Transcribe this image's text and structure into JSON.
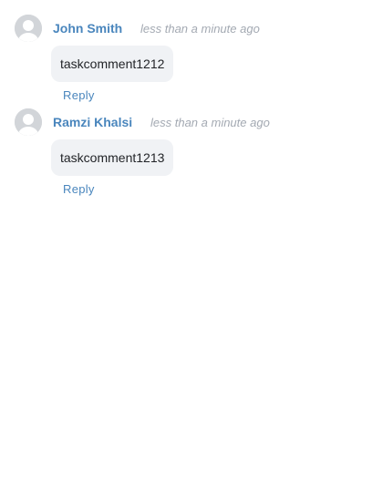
{
  "comments": [
    {
      "author": "John Smith",
      "timestamp": "less than a minute ago",
      "text": "taskcomment1212",
      "reply_label": "Reply",
      "avatar_icon": "default-user-avatar-icon"
    },
    {
      "author": "Ramzi Khalsi",
      "timestamp": "less than a minute ago",
      "text": "taskcomment1213",
      "reply_label": "Reply",
      "avatar_icon": "default-user-avatar-icon"
    }
  ],
  "colors": {
    "link": "#4a86bd",
    "muted": "#a3a9b2",
    "bubble": "#f0f2f5",
    "avatar": "#d2d5d9"
  }
}
